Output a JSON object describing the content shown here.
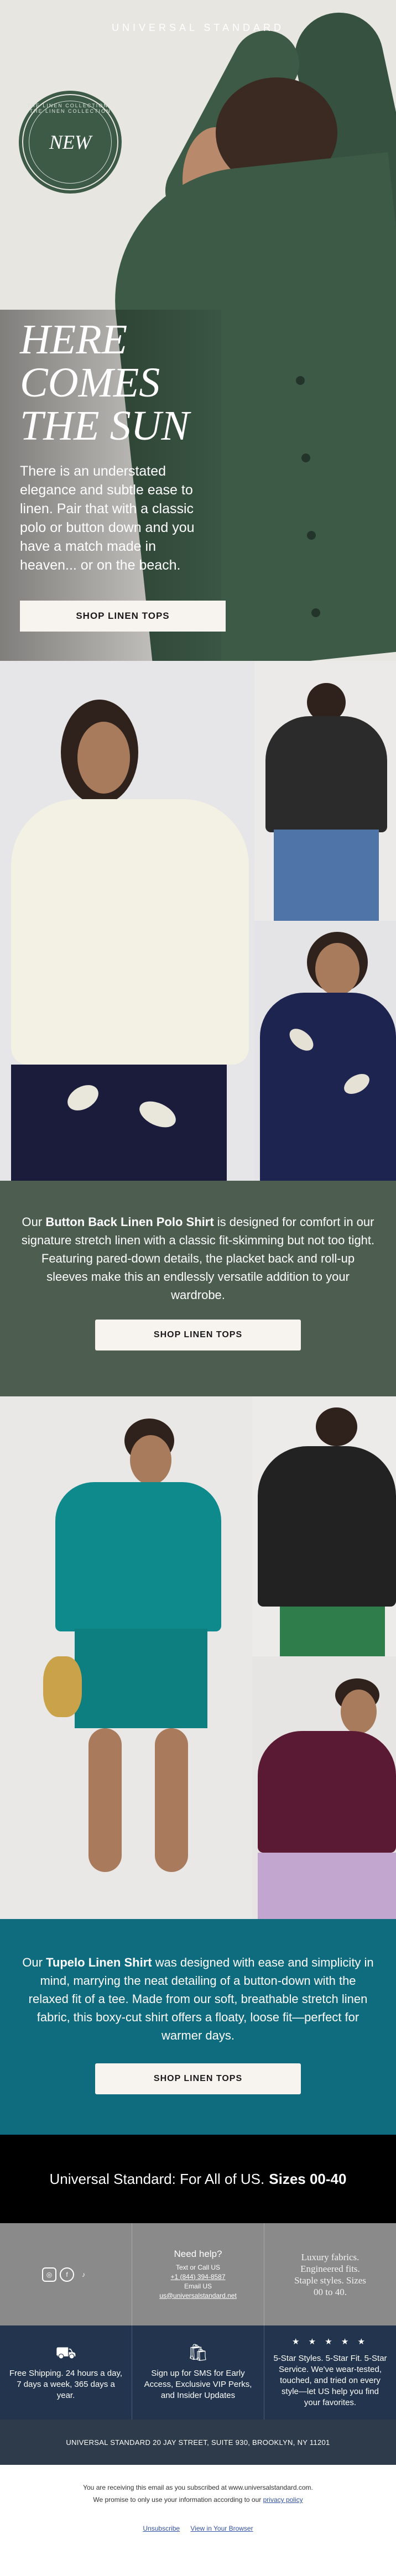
{
  "hero": {
    "brand": "UNIVERSAL STANDARD",
    "badge_label": "NEW",
    "badge_ring_text": "THE LINEN COLLECTION · THE LINEN COLLECTION",
    "headline_lines": [
      "HERE",
      "COMES",
      "THE SUN"
    ],
    "body": "There is an understated elegance and subtle ease to linen. Pair that with a classic polo or button down and you have a match made in heaven... or on the beach.",
    "cta": "SHOP LINEN TOPS"
  },
  "section_polo": {
    "text_pre": "Our ",
    "product": "Button Back Linen Polo Shirt",
    "text_post": " is designed for comfort in our signature stretch linen with a classic fit-skimming but not too tight. Featuring pared-down details, the placket back and roll-up sleeves make this an endlessly versatile addition to your wardrobe.",
    "cta": "SHOP LINEN TOPS",
    "bg": "#4d5e50"
  },
  "section_tupelo": {
    "text_pre": "Our ",
    "product": "Tupelo Linen Shirt",
    "text_post": " was designed with ease and simplicity in mind, marrying the neat detailing of a button-down with the relaxed fit of a tee. Made from our soft, breathable stretch linen fabric, this boxy-cut shirt offers a floaty, loose fit—perfect for warmer days.",
    "cta": "SHOP LINEN TOPS",
    "bg": "#0f6b7e"
  },
  "inclusive": {
    "text": "Universal Standard: For All of US.",
    "sizes": "Sizes 00-40"
  },
  "info": {
    "social_icons": [
      "instagram-icon",
      "facebook-icon",
      "tiktok-icon"
    ],
    "help_title": "Need help?",
    "help_lines": [
      "Text or Call US",
      "+1 (844) 394-8587",
      "Email US",
      "us@universalstandard.net"
    ],
    "tagline": "Luxury fabrics. Engineered fits. Staple styles. Sizes 00 to 40."
  },
  "perks": [
    {
      "icon": "truck-icon",
      "text": "Free Shipping. 24 hours a day, 7 days a week, 365 days a year."
    },
    {
      "icon": "shopping-bag-icon",
      "text": "Sign up for SMS for Early Access, Exclusive VIP Perks, and Insider Updates"
    },
    {
      "icon": "stars-icon",
      "stars": "★ ★ ★ ★ ★",
      "text": "5-Star Styles. 5-Star Fit. 5-Star Service. We've wear-tested, touched, and tried on every style—let US help you find your favorites."
    }
  ],
  "address": "UNIVERSAL STANDARD 20 JAY STREET, SUITE 930, BROOKLYN, NY 11201",
  "legal": {
    "line1": "You are receiving this email as you subscribed at www.universalstandard.com.",
    "line2_pre": "We promise to only use your information according to our ",
    "privacy_link": "privacy policy",
    "unsubscribe": "Unsubscribe",
    "view_browser": "View in Your Browser"
  }
}
